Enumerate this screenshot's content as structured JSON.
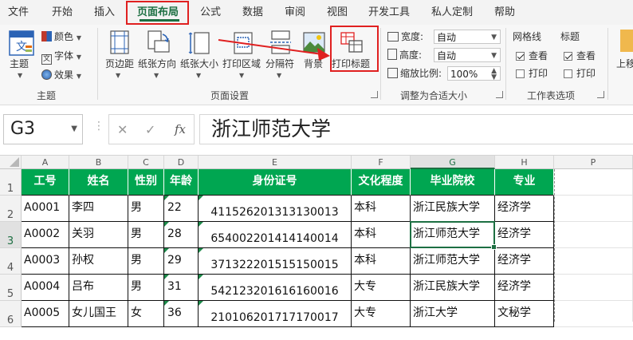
{
  "menu": {
    "items": [
      "文件",
      "开始",
      "插入",
      "页面布局",
      "公式",
      "数据",
      "审阅",
      "视图",
      "开发工具",
      "私人定制",
      "帮助"
    ],
    "active_index": 3
  },
  "ribbon": {
    "theme": {
      "theme_label": "主题",
      "colors_label": "颜色",
      "fonts_label": "字体",
      "effects_label": "效果",
      "group_label": "主题"
    },
    "page_setup": {
      "margins_label": "页边距",
      "orientation_label": "纸张方向",
      "size_label": "纸张大小",
      "print_area_label": "打印区域",
      "breaks_label": "分隔符",
      "background_label": "背景",
      "print_titles_label": "打印标题",
      "group_label": "页面设置"
    },
    "scale_to_fit": {
      "width_label": "宽度:",
      "width_value": "自动",
      "height_label": "高度:",
      "height_value": "自动",
      "scale_label": "缩放比例:",
      "scale_value": "100%",
      "group_label": "调整为合适大小"
    },
    "sheet_options": {
      "gridlines_label": "网格线",
      "headings_label": "标题",
      "view_label": "查看",
      "print_label": "打印",
      "group_label": "工作表选项"
    },
    "arrange": {
      "bring_forward_label": "上移"
    }
  },
  "formula_bar": {
    "name_box": "G3",
    "cancel_symbol": "✕",
    "enter_symbol": "✓",
    "fx_symbol": "fx",
    "content": "浙江师范大学"
  },
  "sheet": {
    "columns": [
      "A",
      "B",
      "C",
      "D",
      "E",
      "F",
      "G",
      "H",
      "P"
    ],
    "rows": [
      "1",
      "2",
      "3",
      "4",
      "5",
      "6"
    ],
    "header": [
      "工号",
      "姓名",
      "性别",
      "年龄",
      "身份证号",
      "文化程度",
      "毕业院校",
      "专业"
    ],
    "data": [
      [
        "A0001",
        "李四",
        "男",
        "22",
        "411526201313130013",
        "本科",
        "浙江民族大学",
        "经济学"
      ],
      [
        "A0002",
        "关羽",
        "男",
        "28",
        "654002201414140014",
        "本科",
        "浙江师范大学",
        "经济学"
      ],
      [
        "A0003",
        "孙权",
        "男",
        "29",
        "371322201515150015",
        "本科",
        "浙江师范大学",
        "经济学"
      ],
      [
        "A0004",
        "吕布",
        "男",
        "31",
        "542123201616160016",
        "大专",
        "浙江民族大学",
        "经济学"
      ],
      [
        "A0005",
        "女儿国王",
        "女",
        "36",
        "210106201717170017",
        "大专",
        "浙江大学",
        "文秘学"
      ]
    ],
    "selected_cell": "G3"
  },
  "colors": {
    "accent": "#1d6f42",
    "header_fill": "#00a651",
    "highlight_box": "#e02020"
  }
}
